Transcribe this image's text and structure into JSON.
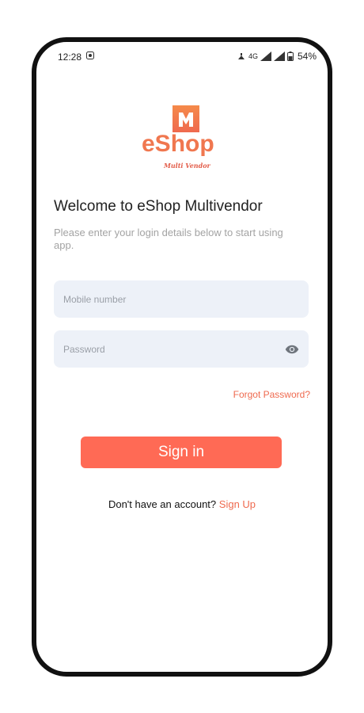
{
  "status_bar": {
    "time": "12:28",
    "network": "4G",
    "battery": "54%"
  },
  "logo": {
    "brand": "eShop",
    "tagline": "Multi Vendor"
  },
  "login": {
    "title": "Welcome to eShop Multivendor",
    "subtitle": "Please enter your login details below to start using app.",
    "mobile_placeholder": "Mobile number",
    "password_placeholder": "Password",
    "forgot_password": "Forgot Password?",
    "signin_label": "Sign in",
    "no_account_text": "Don't have an account?",
    "signup_label": "Sign Up"
  },
  "colors": {
    "accent": "#ff6a55",
    "link": "#ef6a4f",
    "field_bg": "#edf1f8",
    "logo_orange": "#f0774f"
  },
  "icons": {
    "screenshot": "screenshot-icon",
    "signal": "signal-icon",
    "battery": "battery-icon",
    "eye": "eye-icon"
  }
}
